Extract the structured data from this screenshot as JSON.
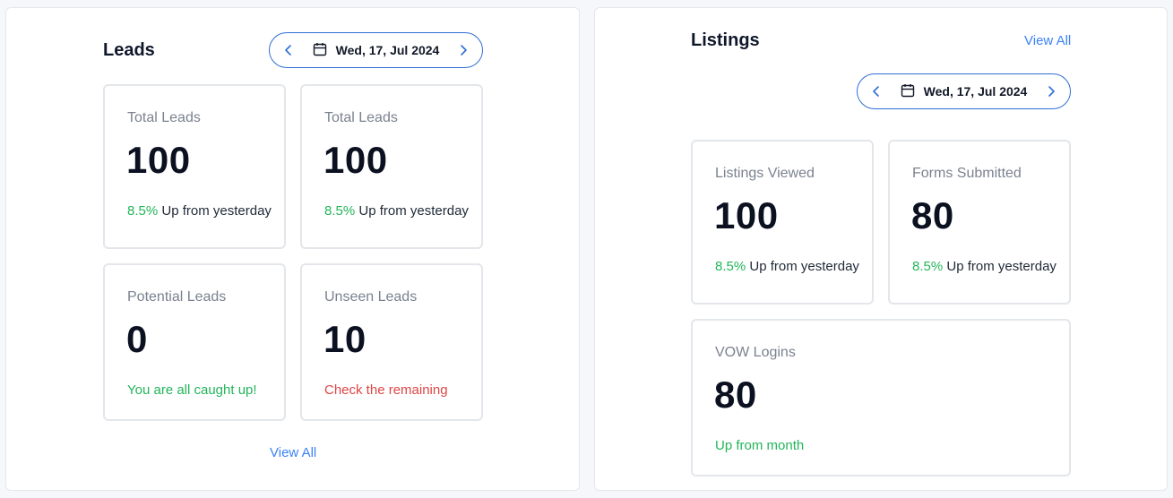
{
  "leads": {
    "title": "Leads",
    "date": "Wed, 17, Jul 2024",
    "view_all": "View All",
    "cards": [
      {
        "label": "Total Leads",
        "value": "100",
        "pct": "8.5%",
        "note": "Up from yesterday"
      },
      {
        "label": "Total Leads",
        "value": "100",
        "pct": "8.5%",
        "note": "Up from yesterday"
      },
      {
        "label": "Potential Leads",
        "value": "0",
        "status": "You are all caught up!"
      },
      {
        "label": "Unseen Leads",
        "value": "10",
        "status": "Check the remaining"
      }
    ]
  },
  "listings": {
    "title": "Listings",
    "view_all": "View All",
    "date": "Wed, 17, Jul 2024",
    "cards": [
      {
        "label": "Listings Viewed",
        "value": "100",
        "pct": "8.5%",
        "note": "Up from yesterday"
      },
      {
        "label": "Forms Submitted",
        "value": "80",
        "pct": "8.5%",
        "note": "Up from yesterday"
      },
      {
        "label": "VOW Logins",
        "value": "80",
        "status": "Up from month"
      }
    ]
  },
  "colors": {
    "accent": "#2f6fd6",
    "link": "#3b82f6",
    "positive": "#22b55a",
    "negative": "#e04545"
  },
  "icons": [
    "chevron-left-icon",
    "calendar-icon",
    "chevron-right-icon"
  ]
}
